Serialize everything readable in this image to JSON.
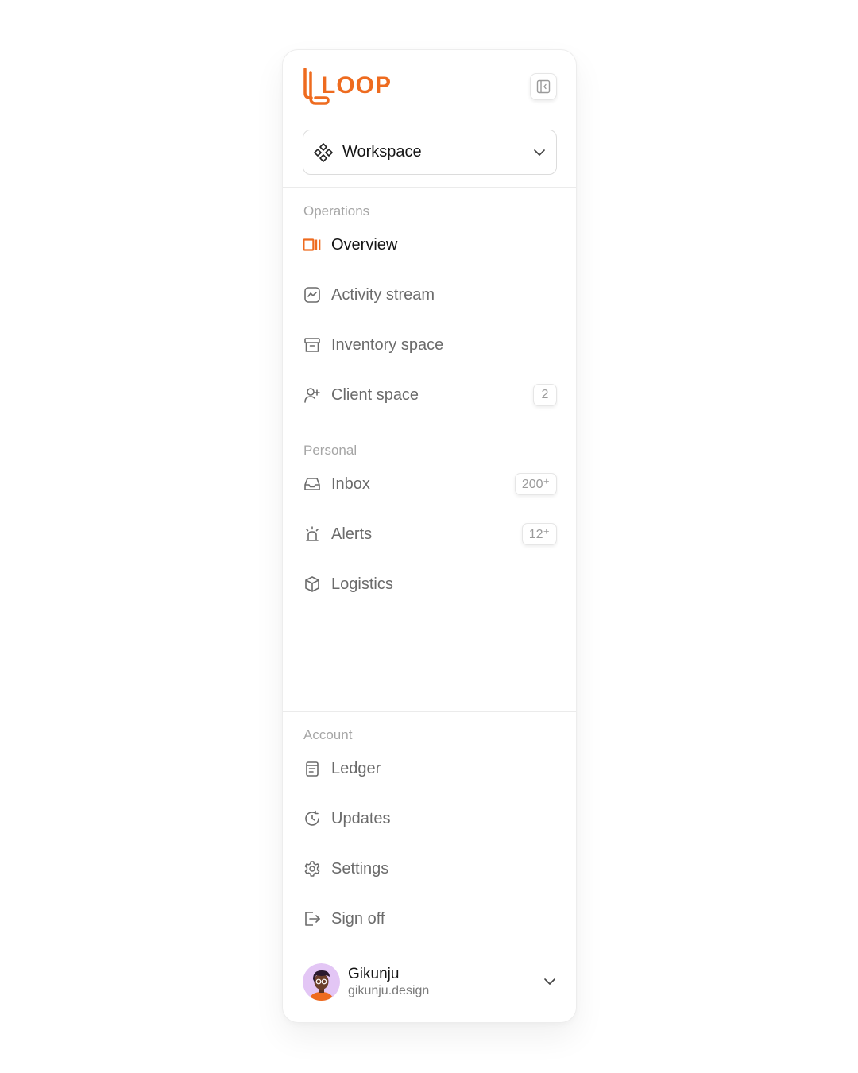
{
  "brand": {
    "name": "LOOP",
    "accent": "#ee6b1f"
  },
  "header": {
    "collapse_icon": "sidebar-collapse-icon"
  },
  "workspace": {
    "label": "Workspace",
    "icon": "workspace-icon"
  },
  "sections": {
    "operations": {
      "label": "Operations",
      "items": [
        {
          "label": "Overview",
          "icon": "overview-icon",
          "active": true
        },
        {
          "label": "Activity stream",
          "icon": "activity-icon"
        },
        {
          "label": "Inventory space",
          "icon": "archive-icon"
        },
        {
          "label": "Client space",
          "icon": "user-plus-icon",
          "badge": "2"
        }
      ]
    },
    "personal": {
      "label": "Personal",
      "items": [
        {
          "label": "Inbox",
          "icon": "inbox-icon",
          "badge": "200⁺"
        },
        {
          "label": "Alerts",
          "icon": "siren-icon",
          "badge": "12⁺"
        },
        {
          "label": "Logistics",
          "icon": "package-icon"
        }
      ]
    },
    "account": {
      "label": "Account",
      "items": [
        {
          "label": "Ledger",
          "icon": "ledger-icon"
        },
        {
          "label": "Updates",
          "icon": "updates-icon"
        },
        {
          "label": "Settings",
          "icon": "gear-icon"
        },
        {
          "label": "Sign off",
          "icon": "sign-off-icon"
        }
      ]
    }
  },
  "user": {
    "name": "Gikunju",
    "handle": "gikunju.design"
  }
}
